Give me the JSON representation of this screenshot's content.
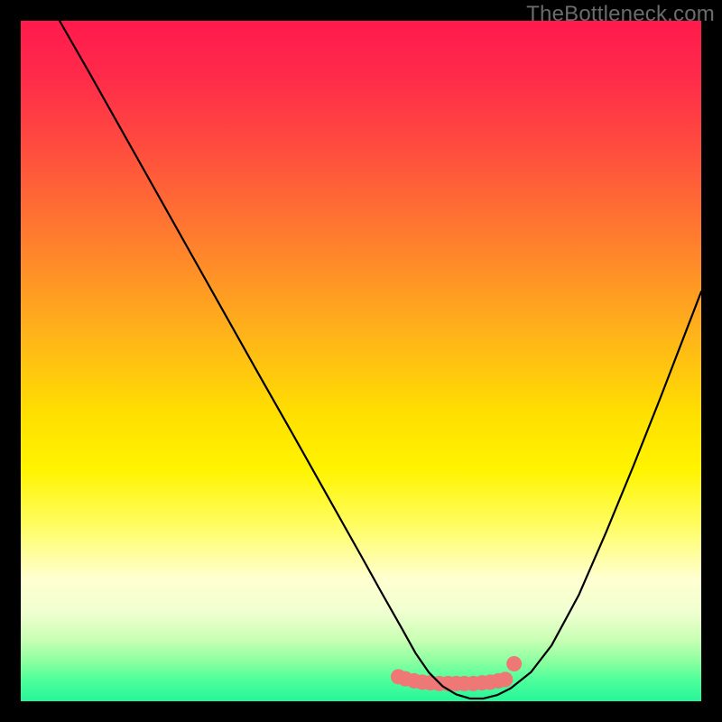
{
  "watermark": {
    "text": "TheBottleneck.com"
  },
  "chart_data": {
    "type": "line",
    "title": "",
    "xlabel": "",
    "ylabel": "",
    "xlim": [
      0,
      100
    ],
    "ylim": [
      0,
      100
    ],
    "grid": false,
    "legend": false,
    "series": [
      {
        "name": "curve",
        "x": [
          5.7,
          10,
          15,
          20,
          25,
          30,
          35,
          40,
          45,
          50,
          53,
          56,
          58,
          60,
          62,
          64,
          66,
          68,
          70,
          72,
          75,
          78,
          82,
          86,
          90,
          94,
          98,
          100
        ],
        "y": [
          100,
          92.5,
          83.6,
          74.7,
          65.8,
          56.9,
          48.0,
          39.2,
          30.3,
          21.4,
          16.0,
          10.7,
          7.1,
          4.2,
          2.2,
          1.0,
          0.4,
          0.4,
          0.9,
          1.9,
          4.3,
          8.2,
          15.6,
          24.8,
          34.5,
          44.6,
          55.0,
          60.2
        ]
      }
    ],
    "continuum_marker": {
      "x": [
        55.5,
        56.5,
        57.8,
        59.0,
        60.2,
        61.5,
        62.8,
        64.0,
        65.2,
        66.5,
        67.8,
        69.0,
        70.2,
        71.2,
        72.5
      ],
      "y": [
        3.6,
        3.3,
        3.0,
        2.8,
        2.7,
        2.6,
        2.6,
        2.6,
        2.6,
        2.6,
        2.7,
        2.8,
        3.0,
        3.2,
        5.5
      ],
      "color": "#ed7875",
      "radius_px": 8.5
    }
  }
}
